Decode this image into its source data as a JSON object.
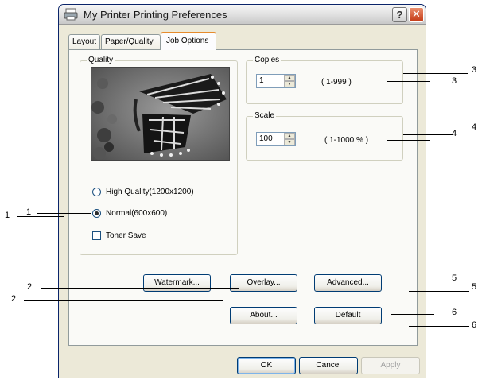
{
  "window": {
    "title": "My Printer Printing Preferences",
    "help_glyph": "?",
    "close_glyph": "✕"
  },
  "tabs": [
    {
      "label": "Layout"
    },
    {
      "label": "Paper/Quality"
    },
    {
      "label": "Job Options"
    }
  ],
  "quality": {
    "group_label": "Quality",
    "options": [
      {
        "label": "High Quality(1200x1200)",
        "selected": false
      },
      {
        "label": "Normal(600x600)",
        "selected": true
      }
    ],
    "toner_save": {
      "label": "Toner Save",
      "checked": false
    }
  },
  "copies": {
    "group_label": "Copies",
    "value": "1",
    "range": "( 1-999 )"
  },
  "scale": {
    "group_label": "Scale",
    "value": "100",
    "range": "( 1-1000 % )"
  },
  "buttons": {
    "watermark": "Watermark...",
    "overlay": "Overlay...",
    "advanced": "Advanced...",
    "about": "About...",
    "default": "Default",
    "ok": "OK",
    "cancel": "Cancel",
    "apply": "Apply"
  },
  "callouts": {
    "left_1a": "1",
    "left_1b": "1",
    "left_2a": "2",
    "left_2b": "2",
    "right_3a": "3",
    "right_3b": "3",
    "right_4a": "4",
    "right_4b": "4",
    "right_5a": "5",
    "right_5b": "5",
    "right_6a": "6",
    "right_6b": "6"
  },
  "colors": {
    "dialog_bg": "#ece9d8",
    "panel_bg": "#fafaf7",
    "active_tab_accent": "#e68b2c",
    "close_button": "#c43a15"
  }
}
